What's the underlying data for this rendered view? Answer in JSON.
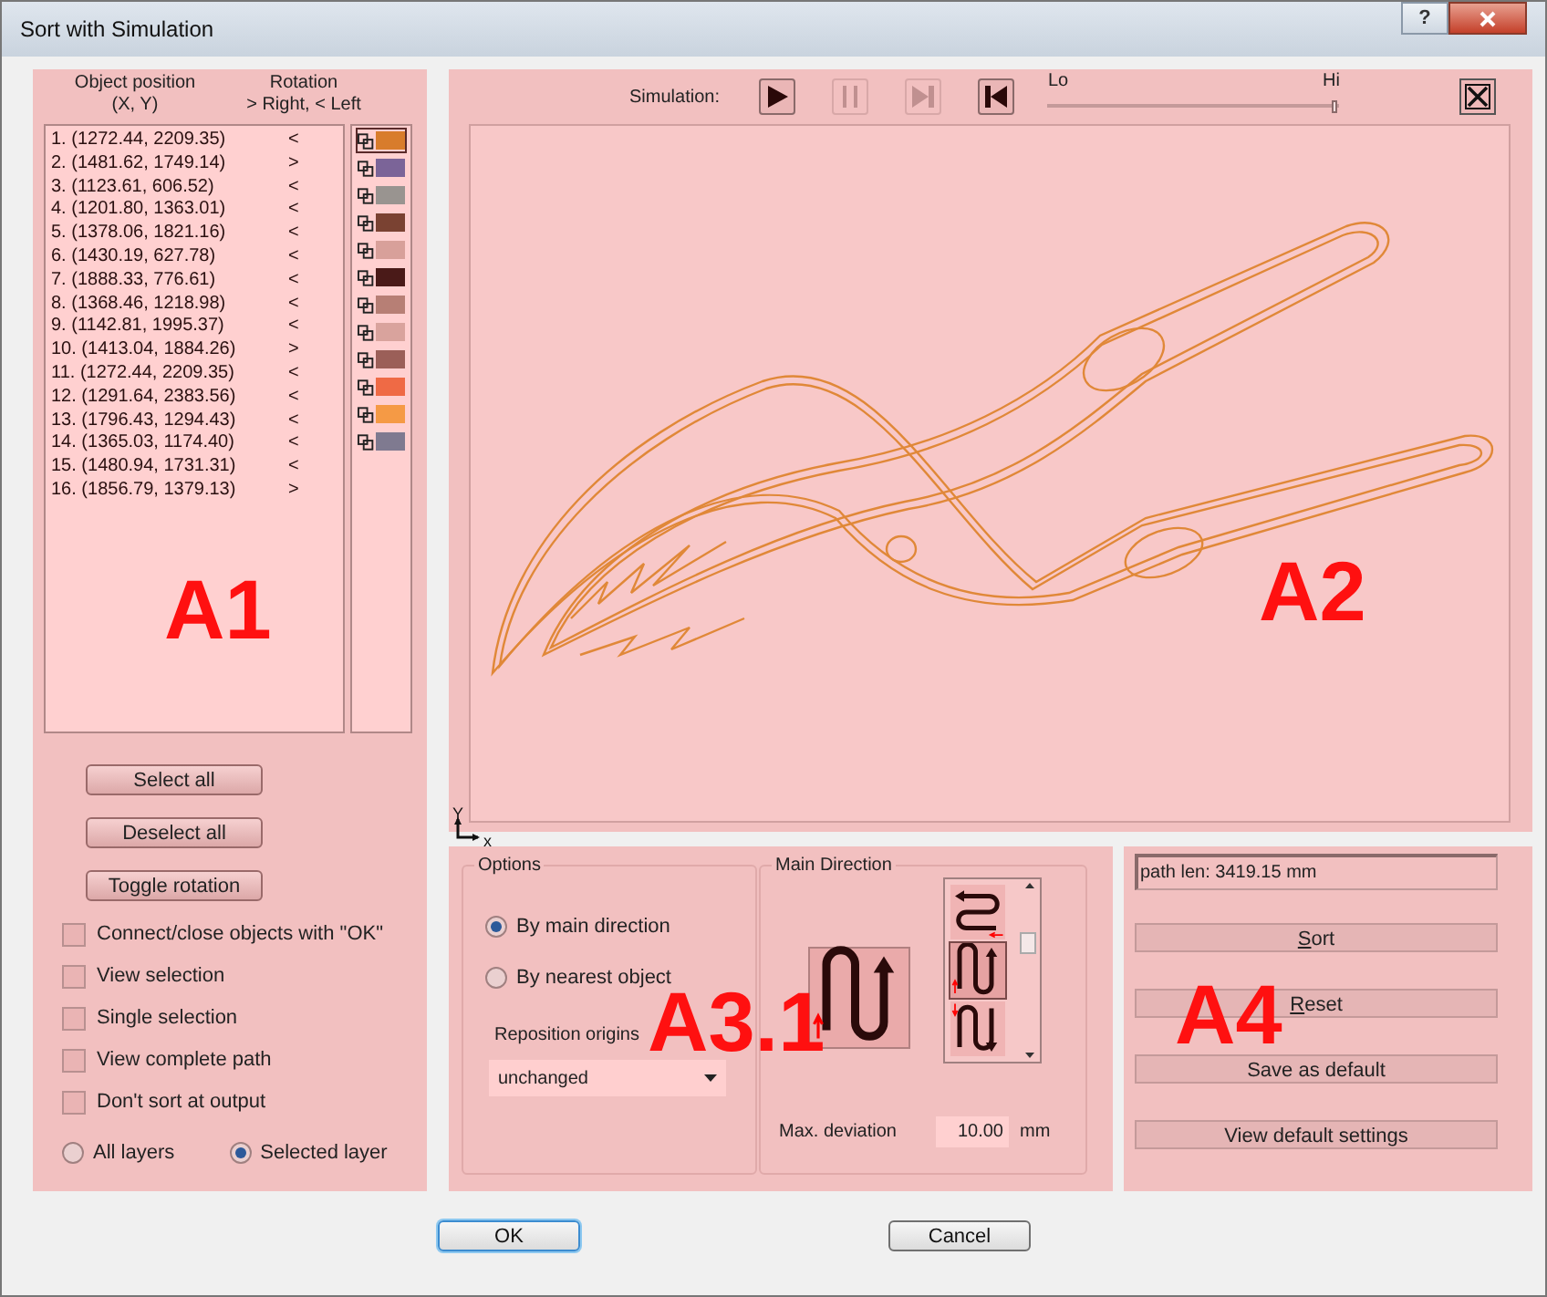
{
  "window": {
    "title": "Sort with Simulation",
    "help_button": "?"
  },
  "objects_panel": {
    "position_header": "Object position",
    "position_subheader": "(X, Y)",
    "rotation_header": "Rotation",
    "rotation_subheader": "> Right, < Left",
    "objects": [
      {
        "position": "1. (1272.44, 2209.35)",
        "rotation": "<"
      },
      {
        "position": "2. (1481.62, 1749.14)",
        "rotation": ">"
      },
      {
        "position": "3. (1123.61, 606.52)",
        "rotation": "<"
      },
      {
        "position": "4. (1201.80, 1363.01)",
        "rotation": "<"
      },
      {
        "position": "5. (1378.06, 1821.16)",
        "rotation": "<"
      },
      {
        "position": "6. (1430.19, 627.78)",
        "rotation": "<"
      },
      {
        "position": "7. (1888.33, 776.61)",
        "rotation": "<"
      },
      {
        "position": "8. (1368.46, 1218.98)",
        "rotation": "<"
      },
      {
        "position": "9. (1142.81, 1995.37)",
        "rotation": "<"
      },
      {
        "position": "10. (1413.04, 1884.26)",
        "rotation": ">"
      },
      {
        "position": "11. (1272.44, 2209.35)",
        "rotation": "<"
      },
      {
        "position": "12. (1291.64, 2383.56)",
        "rotation": "<"
      },
      {
        "position": "13. (1796.43, 1294.43)",
        "rotation": "<"
      },
      {
        "position": "14. (1365.03, 1174.40)",
        "rotation": "<"
      },
      {
        "position": "15. (1480.94, 1731.31)",
        "rotation": "<"
      },
      {
        "position": "16. (1856.79, 1379.13)",
        "rotation": ">"
      }
    ],
    "layers": [
      {
        "color": "#d87c2c",
        "selected": true
      },
      {
        "color": "#7b6498",
        "selected": false
      },
      {
        "color": "#999490",
        "selected": false
      },
      {
        "color": "#7a4232",
        "selected": false
      },
      {
        "color": "#d8a09a",
        "selected": false
      },
      {
        "color": "#4a1a18",
        "selected": false
      },
      {
        "color": "#b77f75",
        "selected": false
      },
      {
        "color": "#d9a39d",
        "selected": false
      },
      {
        "color": "#9b5f58",
        "selected": false
      },
      {
        "color": "#ef6a45",
        "selected": false
      },
      {
        "color": "#f59a45",
        "selected": false
      },
      {
        "color": "#7f7a90",
        "selected": false
      }
    ]
  },
  "selection_buttons": [
    "Select all",
    "Deselect all",
    "Toggle rotation"
  ],
  "checkboxes": [
    {
      "label": "Connect/close objects with \"OK\"",
      "checked": false
    },
    {
      "label": "View selection",
      "checked": false
    },
    {
      "label": "Single selection",
      "checked": false
    },
    {
      "label": "View complete path",
      "checked": false
    },
    {
      "label": "Don't sort at output",
      "checked": false
    }
  ],
  "layer_scope": [
    {
      "label": "All layers",
      "selected": false
    },
    {
      "label": "Selected layer",
      "selected": true
    }
  ],
  "simulation": {
    "label": "Simulation:",
    "controls": [
      {
        "kind": "play",
        "disabled": false
      },
      {
        "kind": "pause",
        "disabled": true
      },
      {
        "kind": "step",
        "disabled": true
      },
      {
        "kind": "rewind",
        "disabled": false
      }
    ],
    "speed_low": "Lo",
    "speed_high": "Hi",
    "level": 0.99
  },
  "canvas": {
    "axis_y": "Y",
    "axis_x": "x"
  },
  "options": {
    "title": "Options",
    "modes": [
      {
        "label": "By main direction",
        "selected": true
      },
      {
        "label": "By nearest object",
        "selected": false
      }
    ],
    "reposition_label": "Reposition origins",
    "reposition_value": "unchanged"
  },
  "main_direction": {
    "title": "Main Direction",
    "patterns": [
      {
        "kind": "left",
        "selected": false
      },
      {
        "kind": "up",
        "selected": true
      },
      {
        "kind": "down",
        "selected": false
      }
    ],
    "max_deviation_label": "Max. deviation",
    "max_deviation": "10.00",
    "unit": "mm"
  },
  "result": {
    "path_length": "path len: 3419.15 mm",
    "buttons": [
      {
        "label": "Sort",
        "accelerator": true
      },
      {
        "label": "Reset",
        "accelerator": true
      },
      {
        "label": "Save as default",
        "accelerator": false
      },
      {
        "label": "View default settings",
        "accelerator": false
      }
    ]
  },
  "footer_buttons": [
    {
      "label": "OK",
      "default": true
    },
    {
      "label": "Cancel",
      "default": false
    }
  ],
  "annotations": [
    "A1",
    "A2",
    "A3.1",
    "A4"
  ]
}
